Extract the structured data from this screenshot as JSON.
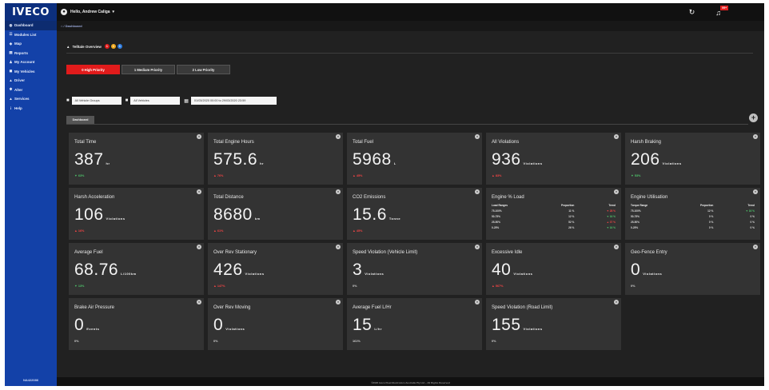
{
  "brand": {
    "logo": "IVECO",
    "sidebar_footer": "NA422086"
  },
  "sidebar": {
    "items": [
      {
        "label": "Dashboard",
        "icon": "dashboard-icon",
        "glyph": "◍",
        "active": true
      },
      {
        "label": "Modules List",
        "icon": "list-icon",
        "glyph": "☰"
      },
      {
        "label": "Map",
        "icon": "map-icon",
        "glyph": "◈"
      },
      {
        "label": "Reports",
        "icon": "reports-icon",
        "glyph": "▤"
      },
      {
        "label": "My Account",
        "icon": "account-icon",
        "glyph": "♟"
      },
      {
        "label": "My Vehicles",
        "icon": "vehicles-icon",
        "glyph": "◼"
      },
      {
        "label": "Driver",
        "icon": "driver-icon",
        "glyph": "▲"
      },
      {
        "label": "Alter",
        "icon": "alter-icon",
        "glyph": "✱"
      },
      {
        "label": "Services",
        "icon": "services-icon",
        "glyph": "▲"
      },
      {
        "label": "Help",
        "icon": "help-icon",
        "glyph": "i"
      }
    ]
  },
  "topbar": {
    "greeting": "Hello, Andrew Caliga",
    "notif_count": "99+"
  },
  "breadcrumb": "⌂ / Dashboard",
  "overview": {
    "title": "Telltale Overview",
    "dots": [
      {
        "label": "1",
        "color": "#e11b1b"
      },
      {
        "label": "1",
        "color": "#f0a81a"
      },
      {
        "label": "1",
        "color": "#2f7de0"
      }
    ]
  },
  "priority_tabs": [
    "0 High Priority",
    "1 Medium Priority",
    "2 Low Priority"
  ],
  "filters": {
    "vehicle_groups": "All Vehicle Groups",
    "vehicles": "All Vehicles",
    "date_range": "01/03/2020 00:00 to 29/03/2020 23:59"
  },
  "dashboard_tab": "Dashboard",
  "cards": [
    {
      "title": "Total Time",
      "value": "387",
      "unit": "hr",
      "trend": "63%",
      "dir": "up"
    },
    {
      "title": "Total Engine Hours",
      "value": "575.6",
      "unit": "hr",
      "trend": "76%",
      "dir": "down"
    },
    {
      "title": "Total Fuel",
      "value": "5968",
      "unit": "L",
      "trend": "45%",
      "dir": "down"
    },
    {
      "title": "All Violations",
      "value": "936",
      "unit": "Violations",
      "trend": "83%",
      "dir": "down"
    },
    {
      "title": "Harsh Braking",
      "value": "206",
      "unit": "Violations",
      "trend": "53%",
      "dir": "up"
    },
    {
      "title": "Harsh Acceleration",
      "value": "106",
      "unit": "Violations",
      "trend": "16%",
      "dir": "down"
    },
    {
      "title": "Total Distance",
      "value": "8680",
      "unit": "km",
      "trend": "61%",
      "dir": "down"
    },
    {
      "title": "CO2 Emissions",
      "value": "15.6",
      "unit": "Tonne",
      "trend": "45%",
      "dir": "down"
    },
    {
      "title": "Engine % Load",
      "table": {
        "headers": [
          "Load Ranges",
          "Proportion",
          "Trend"
        ],
        "rows": [
          [
            "75-100%",
            "11 %",
            "▼ 28 %",
            "rd"
          ],
          [
            "50-75%",
            "12 %",
            "▼ 16 %",
            "g"
          ],
          [
            "25-50%",
            "52 %",
            "▲ 37 %",
            "rd"
          ],
          [
            "0-25%",
            "26 %",
            "▼ 16 %",
            "g"
          ]
        ]
      }
    },
    {
      "title": "Engine Utilisation",
      "table": {
        "headers": [
          "Torque Range",
          "Proportion",
          "Trend"
        ],
        "rows": [
          [
            "75-100%",
            "12 %",
            "▼ 16 %",
            "g"
          ],
          [
            "50-75%",
            "0 %",
            "0 %",
            ""
          ],
          [
            "25-50%",
            "0 %",
            "0 %",
            ""
          ],
          [
            "0-25%",
            "0 %",
            "0 %",
            ""
          ]
        ]
      }
    },
    {
      "title": "Average Fuel",
      "value": "68.76",
      "unit": "L/100km",
      "trend": "13%",
      "dir": "up"
    },
    {
      "title": "Over Rev Stationary",
      "value": "426",
      "unit": "Violations",
      "trend": "147%",
      "dir": "down"
    },
    {
      "title": "Speed Violation (Vehicle Limit)",
      "value": "3",
      "unit": "Violations",
      "trend": "0%",
      "dir": "flat"
    },
    {
      "title": "Excessive Idle",
      "value": "40",
      "unit": "Violations",
      "trend": "567%",
      "dir": "down"
    },
    {
      "title": "Geo-Fence Entry",
      "value": "0",
      "unit": "Violations",
      "trend": "0%",
      "dir": "flat"
    },
    {
      "title": "Brake Air Pressure",
      "value": "0",
      "unit": "Events",
      "trend": "0%",
      "dir": "flat"
    },
    {
      "title": "Over Rev Moving",
      "value": "0",
      "unit": "Violations",
      "trend": "0%",
      "dir": "flat"
    },
    {
      "title": "Average Fuel L/Hr",
      "value": "15",
      "unit": "L/hr",
      "trend": "161%",
      "dir": "flat"
    },
    {
      "title": "Speed Violation (Road Limit)",
      "value": "155",
      "unit": "Violations",
      "trend": "0%",
      "dir": "flat"
    }
  ],
  "footer": "©2020 Iveco Fleet Electronics Australia Pty Ltd – All Rights Reserved"
}
